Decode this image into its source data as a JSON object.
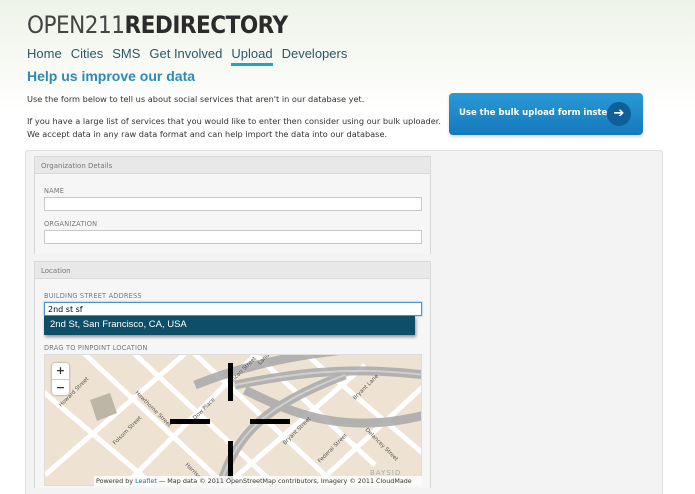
{
  "logo": {
    "thin": "OPEN211",
    "bold": "REDIRECTORY"
  },
  "nav": [
    {
      "label": "Home",
      "active": false
    },
    {
      "label": "Cities",
      "active": false
    },
    {
      "label": "SMS",
      "active": false
    },
    {
      "label": "Get Involved",
      "active": false
    },
    {
      "label": "Upload",
      "active": true
    },
    {
      "label": "Developers",
      "active": false
    }
  ],
  "page_title": "Help us improve our data",
  "intro": {
    "p1": "Use the form below to tell us about social services that aren't in our database yet.",
    "p2": "If you have a large list of services that you would like to enter then consider using our bulk uploader. We accept data in any raw data format and can help import the data into our database."
  },
  "bulk_button": {
    "label": "Use the bulk upload form instead",
    "icon": "arrow-right-icon"
  },
  "org_section": {
    "heading": "Organization Details",
    "name_label": "NAME",
    "name_value": "",
    "org_label": "ORGANIZATION",
    "org_value": ""
  },
  "location_section": {
    "heading": "Location",
    "address_label": "BUILDING STREET ADDRESS",
    "address_value": "2nd st sf",
    "suggestion": "2nd St, San Francisco, CA, USA",
    "pinpoint_label": "DRAG TO PINPOINT LOCATION"
  },
  "map": {
    "zoom_in": "+",
    "zoom_out": "−",
    "attribution_prefix": "Powered by ",
    "attribution_link": "Leaflet",
    "attribution_rest": " — Map data © 2011 OpenStreetMap contributors, Imagery © 2011 CloudMade",
    "streets": {
      "howard": "Howard Street",
      "hawthorne": "Hawthorne Street",
      "folsom": "Folsom Street",
      "dow": "Dow Place",
      "harrison": "Harrison Street",
      "rincon": "Rincon Street",
      "bryant": "Bryant Street",
      "federal": "Federal Street",
      "delancey": "Delancey Street",
      "bryant_lane": "Bryant Lane",
      "landers": "Landers",
      "bay": "BAYSID"
    }
  },
  "colors": {
    "accent": "#2c8bb3",
    "nav_underline": "#1da5c9",
    "button_blue": "#1a86c8",
    "suggestion_bg": "#0e4f67",
    "map_bg": "#eee3d2"
  }
}
